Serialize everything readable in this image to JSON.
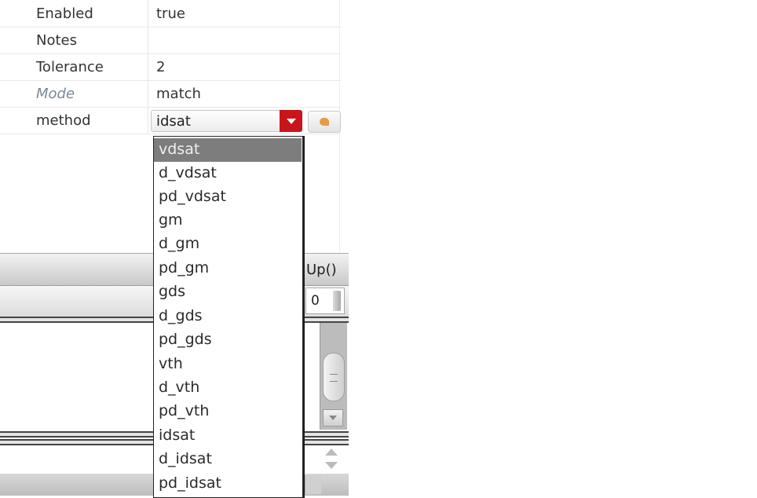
{
  "properties": {
    "rows": [
      {
        "key": "Enabled",
        "value": "true"
      },
      {
        "key": "Notes",
        "value": ""
      },
      {
        "key": "Tolerance",
        "value": "2"
      },
      {
        "key": "Mode",
        "value": "match"
      },
      {
        "key": "method",
        "value": ""
      }
    ]
  },
  "method_combo": {
    "value": "idsat",
    "options": [
      "vdsat",
      "d_vdsat",
      "pd_vdsat",
      "gm",
      "d_gm",
      "pd_gm",
      "gds",
      "d_gds",
      "pd_gds",
      "vth",
      "d_vth",
      "pd_vth",
      "idsat",
      "d_idsat",
      "pd_idsat"
    ],
    "highlighted": "vdsat"
  },
  "background": {
    "header_label": "Up()",
    "spin_value": "0"
  },
  "colors": {
    "combo_arrow": "#c8141b",
    "highlight": "#7d7d7d",
    "reset_icon": "#e89a44"
  },
  "icons": {
    "combo_arrow": "chevron-down-icon",
    "reset": "reset-icon"
  }
}
